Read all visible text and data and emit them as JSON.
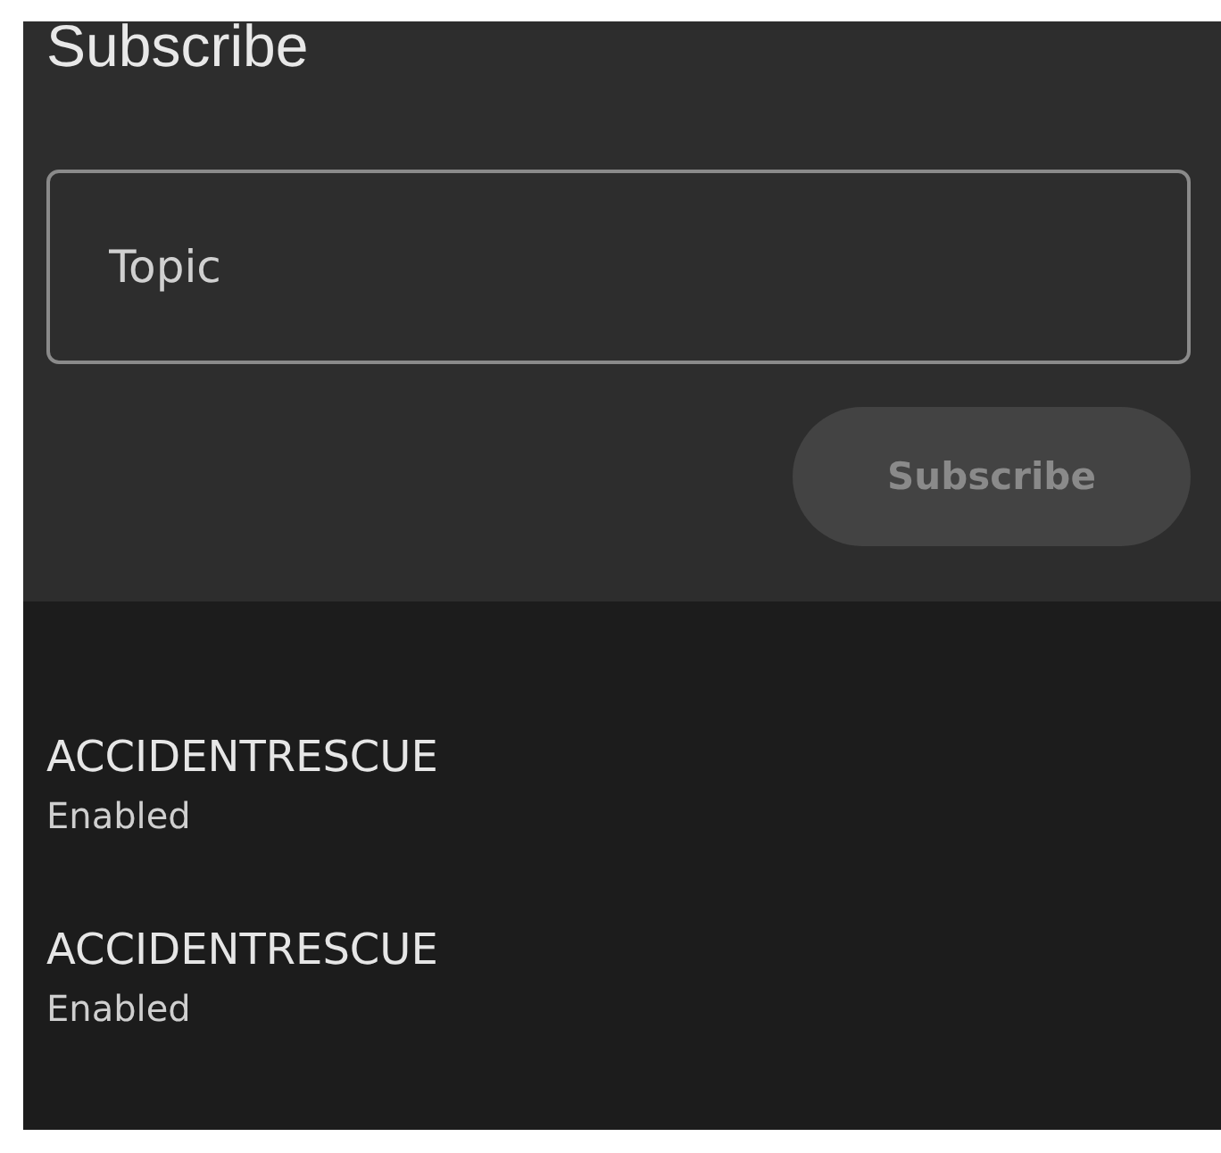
{
  "subscribe_panel": {
    "title": "Subscribe",
    "topic_field": {
      "placeholder": "Topic"
    },
    "button": {
      "label": "Subscribe",
      "disabled": true
    }
  },
  "subscriptions": [
    {
      "topic": "ACCIDENTRESCUE",
      "status": "Enabled"
    },
    {
      "topic": "ACCIDENTRESCUE",
      "status": "Enabled"
    }
  ]
}
